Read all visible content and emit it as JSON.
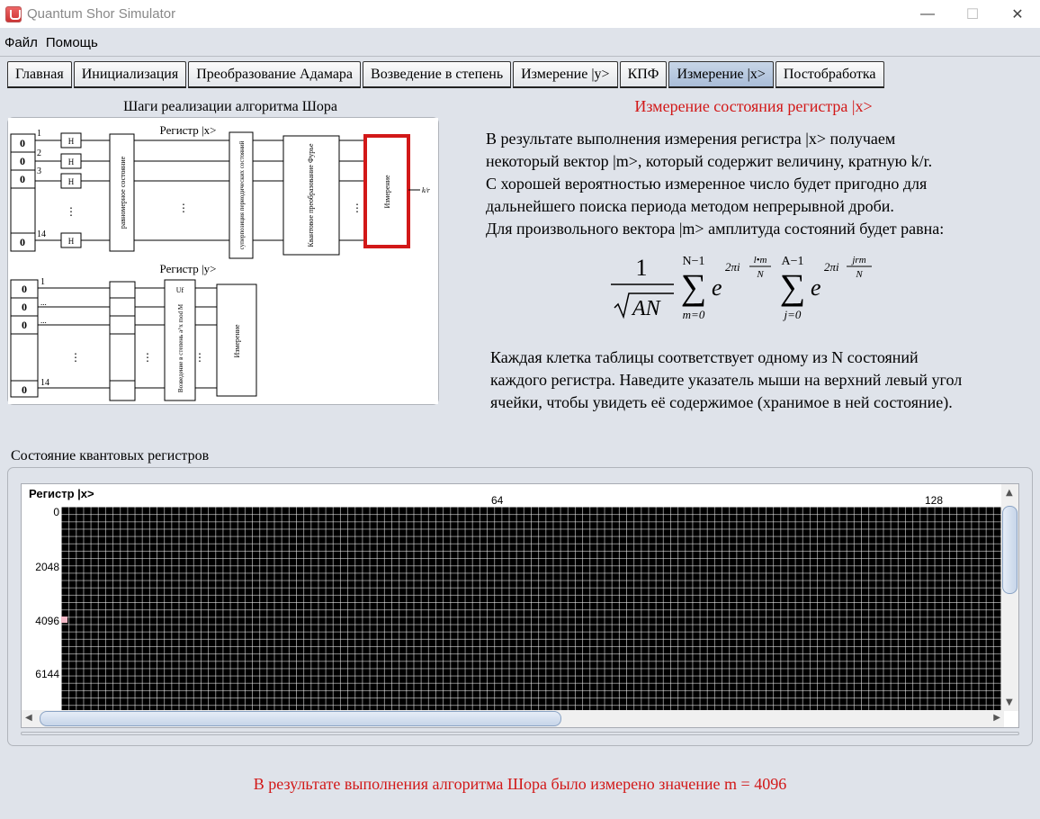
{
  "window": {
    "title": "Quantum Shor Simulator",
    "minimize": "—",
    "maximize": "☐",
    "close": "✕"
  },
  "menu": {
    "file": "Файл",
    "help": "Помощь"
  },
  "tabs": [
    {
      "label": "Главная"
    },
    {
      "label": "Инициализация"
    },
    {
      "label": "Преобразование Адамара"
    },
    {
      "label": "Возведение в степень"
    },
    {
      "label": "Измерение |y>"
    },
    {
      "label": "КПФ"
    },
    {
      "label": "Измерение |x>",
      "active": true
    },
    {
      "label": "Постобработка"
    }
  ],
  "steps": {
    "title": "Шаги реализации алгоритма Шора",
    "reg_x": "Регистр |x>",
    "reg_y": "Регистр |y>",
    "bits_x": [
      "0",
      "0",
      "0",
      "0"
    ],
    "bits_y": [
      "0",
      "0",
      "0",
      "0"
    ],
    "line_nums": [
      "1",
      "2",
      "3",
      "14"
    ],
    "gate_h": "H",
    "box_superposition_equal": "равномерное состояние",
    "box_superposition_periodic": "суперпозиция периодических состояний",
    "box_qft": "Квантовое преобразование Фурье",
    "box_measure_x": "Измерение",
    "box_modexp": "Возведение в степень a^x mod M",
    "box_measure_y": "Измерение",
    "uf": "Uf",
    "output": "k/r",
    "dots": "⋮",
    "dots_h": "..."
  },
  "right": {
    "title": "Измерение состояния регистра |x>",
    "desc_lines": [
      "В результате выполнения измерения регистра |x> получаем",
      "некоторый вектор |m>, который содержит величину, кратную k/r.",
      "С хорошей вероятностью измеренное число будет пригодно для",
      "дальнейшего поиска периода методом непрерывной дроби.",
      "Для произвольного вектора |m> амплитуда состояний будет равна:"
    ],
    "formula": {
      "one": "1",
      "sqrt_arg": "AN",
      "sum1_top": "N−1",
      "sum1_bot": "m=0",
      "e": "e",
      "exp1_a": "2πi",
      "exp1_num": "l•m",
      "exp1_den": "N",
      "sum2_top": "A−1",
      "sum2_bot": "j=0",
      "exp2_a": "2πi",
      "exp2_num": "jrm",
      "exp2_den": "N"
    },
    "desc2_lines": [
      "Каждая клетка таблицы соответствует одному из N состояний",
      "каждого регистра. Наведите указатель мыши на верхний левый угол",
      "ячейки, чтобы увидеть её содержимое (хранимое в ней состояние)."
    ]
  },
  "registers": {
    "label": "Состояние квантовых регистров",
    "header": "Регистр |x>",
    "cols": [
      "64",
      "128"
    ],
    "rows": [
      "0",
      "2048",
      "4096",
      "6144"
    ]
  },
  "result": "В результате выполнения алгоритма Шора было измерено значение m = 4096",
  "colors": {
    "accent_red": "#d21818",
    "active_tab": "#b3c6de",
    "grid": "#000000",
    "highlight_cell": "#f2b8c6"
  }
}
